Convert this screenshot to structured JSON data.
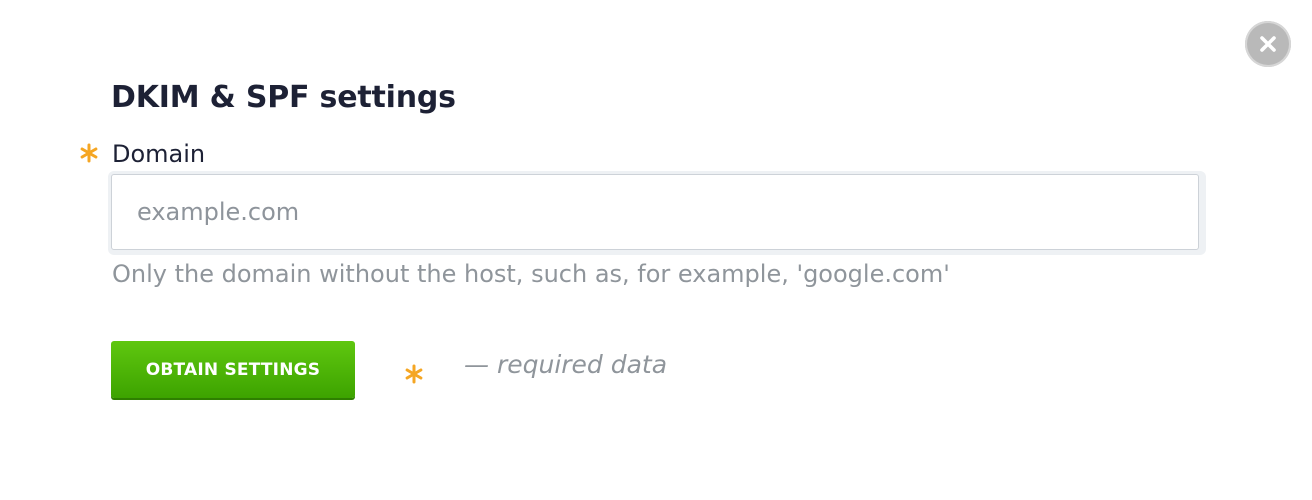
{
  "dialog": {
    "title": "DKIM & SPF settings",
    "close_icon": "close-icon"
  },
  "form": {
    "domain_label": "Domain",
    "domain_required_icon": "asterisk-icon",
    "domain_placeholder": "example.com",
    "domain_value": "",
    "domain_hint": "Only the domain without the host, such as, for example, 'google.com'",
    "submit_label": "OBTAIN SETTINGS",
    "required_note": "— required data"
  },
  "colors": {
    "accent_green": "#4cb606",
    "required_orange": "#f5a623",
    "title_text": "#1d2135",
    "muted_text": "#8f959b"
  }
}
